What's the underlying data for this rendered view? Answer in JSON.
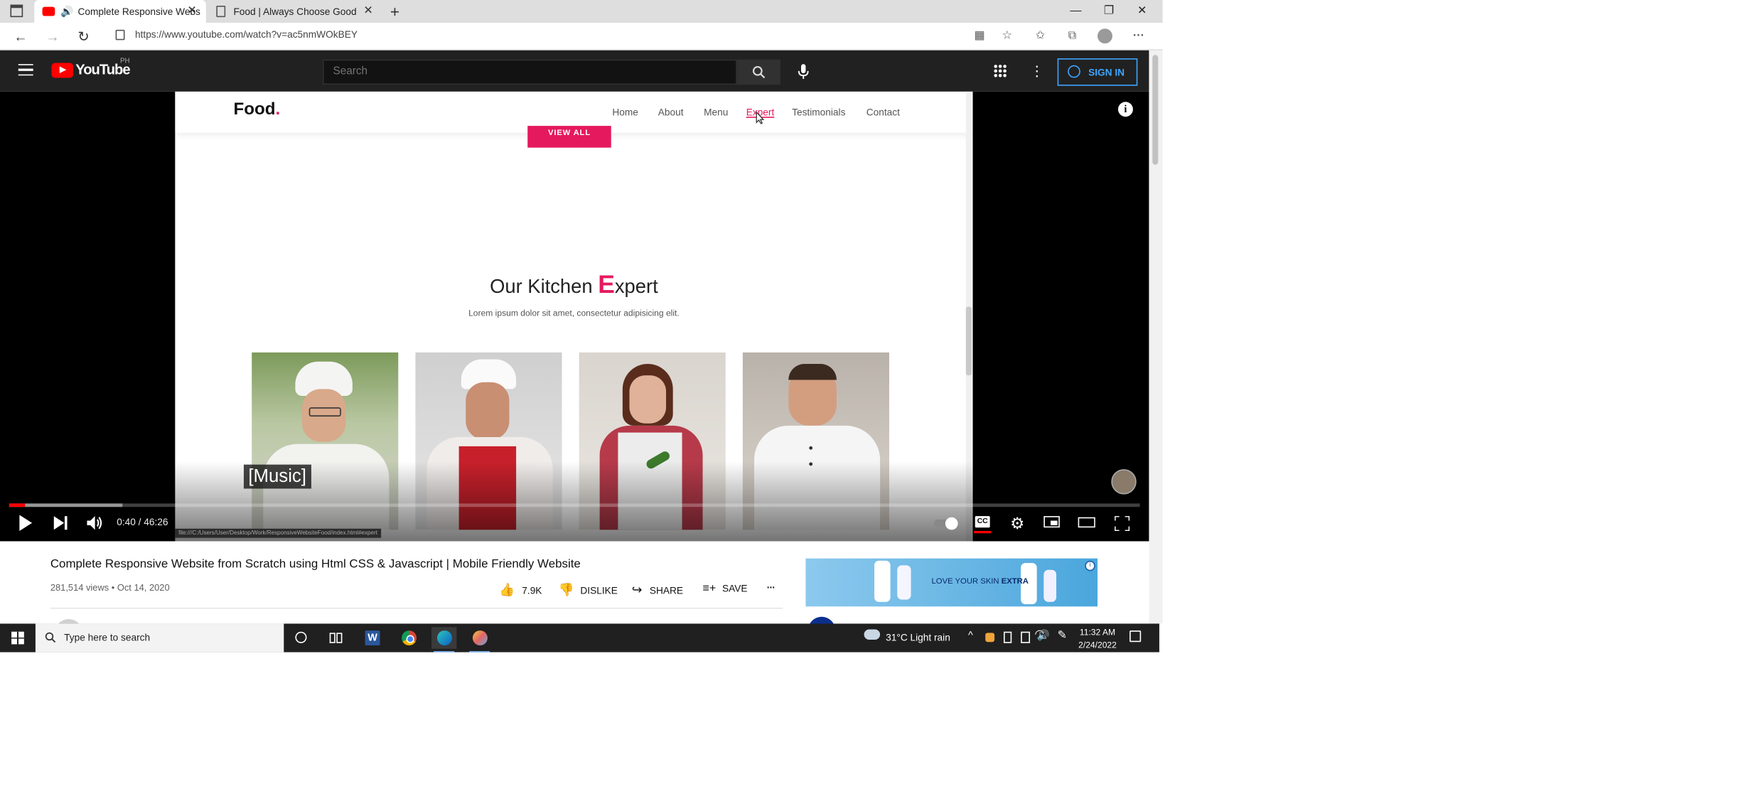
{
  "browser": {
    "tabs": [
      {
        "title": "Complete Responsive Webs",
        "active": true
      },
      {
        "title": "Food | Always Choose Good",
        "active": false
      }
    ],
    "url": "https://www.youtube.com/watch?v=ac5nmWOkBEY"
  },
  "youtube": {
    "logo_text": "YouTube",
    "region": "PH",
    "search_placeholder": "Search",
    "signin_label": "SIGN IN"
  },
  "video_page": {
    "nav": [
      "Home",
      "About",
      "Menu",
      "Expert",
      "Testimonials",
      "Contact"
    ],
    "logo": "Food",
    "logo_dot": ".",
    "view_all": "VIEW ALL",
    "section_title_prefix": "Our Kitchen ",
    "section_title_letter": "E",
    "section_title_suffix": "xpert",
    "section_subtitle": "Lorem ipsum dolor sit amet, consectetur adipisicing elit.",
    "status_url": "file:///C:/Users/User/Desktop/Work/ResponsiveWebsiteFood/index.html#expert"
  },
  "player": {
    "caption": "[Music]",
    "time": "0:40 / 46:26",
    "played_fraction": 0.0144,
    "buffered_fraction": 0.1
  },
  "video": {
    "title": "Complete Responsive Website from Scratch using Html CSS & Javascript | Mobile Friendly Website",
    "meta": "281,514 views • Oct 14, 2020",
    "likes": "7.9K",
    "dislike_label": "DISLIKE",
    "share_label": "SHARE",
    "save_label": "SAVE",
    "more_label": "..."
  },
  "ad": {
    "text_prefix": "LOVE YOUR SKIN ",
    "text_bold": "EXTRA"
  },
  "taskbar": {
    "search_placeholder": "Type here to search",
    "weather": "31°C  Light rain",
    "time": "11:32 AM",
    "date": "2/24/2022"
  },
  "colors": {
    "accent_pink": "#e5195e",
    "youtube_red": "#ff0000",
    "signin_blue": "#3ea6ff"
  }
}
